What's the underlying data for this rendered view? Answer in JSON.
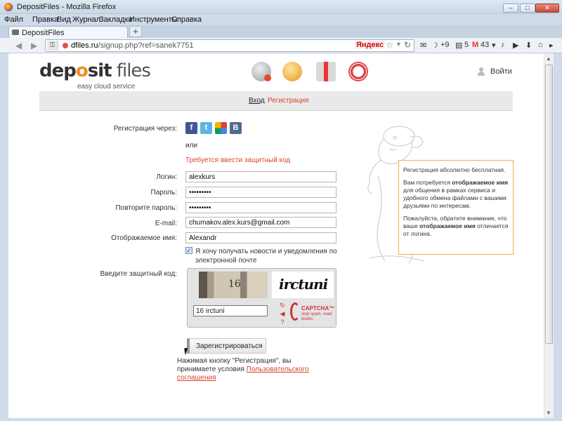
{
  "window": {
    "title": "DepositFiles - Mozilla Firefox",
    "buttons": {
      "minimize": "–",
      "maximize": "□",
      "close": "✕"
    }
  },
  "menu": [
    "Файл",
    "Правка",
    "Вид",
    "Журнал",
    "Закладки",
    "Инструменты",
    "Справка"
  ],
  "tab": {
    "label": "DepositFiles",
    "new_tab": "+"
  },
  "nav": {
    "back": "◀",
    "forward": "▶",
    "url_domain": "dfiles.ru",
    "url_path": "/signup.php?ref=sanek7751",
    "search_engine": "Яндекс",
    "addons": {
      "weather": "+9",
      "mail_count": "5",
      "gmail_count": "43"
    }
  },
  "site": {
    "logo_main_a": "dep",
    "logo_main_dot": "o",
    "logo_main_b": "sit",
    "logo_main_c": " files",
    "logo_sub": "easy cloud service",
    "login_link": "Войти",
    "subnav": {
      "login": "Вход",
      "register": "Регистрация"
    }
  },
  "form": {
    "register_via_label": "Регистрация через:",
    "social": [
      "f",
      "t",
      "g",
      "B"
    ],
    "or": "или",
    "captcha_required": "Требуется ввести защитный код",
    "login_label": "Логин:",
    "login_value": "alexkurs",
    "password_label": "Пароль:",
    "password_value": "•••••••••",
    "repeat_password_label": "Повторите пароль:",
    "repeat_password_value": "•••••••••",
    "email_label": "E-mail:",
    "email_value": "chumakov.alex.kurs@gmail.com",
    "display_name_label": "Отображаемое имя:",
    "display_name_value": "Alexandr",
    "newsletter_checked": "✓",
    "newsletter_label": "Я хочу получать новости и уведомления по электронной почте",
    "captcha_label": "Введите защитный код:",
    "captcha_image1_text": "16",
    "captcha_image2_text": "irctuni",
    "captcha_value": "16 irctuni",
    "captcha_controls": [
      "↻",
      "◀",
      "?"
    ],
    "recaptcha_brand": "CAPTCHA™",
    "recaptcha_tagline": "stop spam. read books.",
    "submit_label": "Зарегистрироваться",
    "terms_text": "Нажимая кнопку \"Регистрация\", вы принимаете условия ",
    "terms_link": "Пользовательского соглашения"
  },
  "info": {
    "p1": "Регистрация абсолютно бесплатная.",
    "p2_a": "Вам потребуется ",
    "p2_b": "отображаемое имя",
    "p2_c": " для общения в рамках сервиса и удобного обмена файлами с вашими друзьями по интересам.",
    "p3_a": "Пожалуйста, обратите внимание, что ваше ",
    "p3_b": "отображаемое имя",
    "p3_c": " отличается от логина."
  },
  "colors": {
    "accent": "#d9442b",
    "info_border": "#e8b34a",
    "brand_orange": "#f38b1b"
  }
}
